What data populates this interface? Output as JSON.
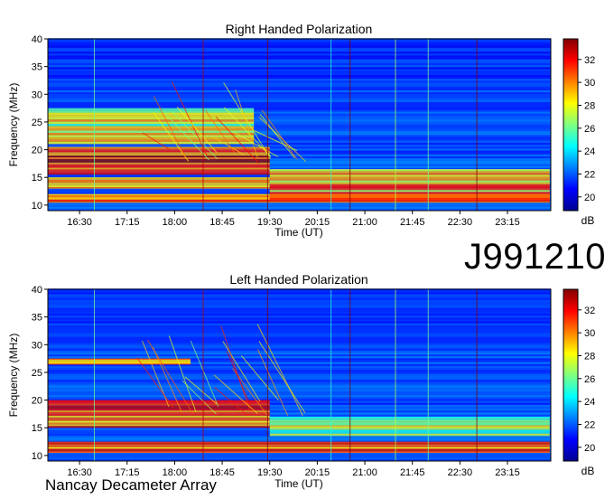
{
  "observation_id": "J991210",
  "credit": "Nancay Decameter Array",
  "chart_data": [
    {
      "type": "heatmap",
      "title": "Right Handed Polarization",
      "xlabel": "Time (UT)",
      "ylabel": "Frequency (MHz)",
      "x_tick_labels": [
        "16:30",
        "17:15",
        "18:00",
        "18:45",
        "19:30",
        "20:15",
        "21:00",
        "21:45",
        "22:30",
        "23:15"
      ],
      "y_ticks": [
        10,
        15,
        20,
        25,
        30,
        35,
        40
      ],
      "ylim": [
        9,
        40
      ],
      "colorbar": {
        "label": "dB",
        "ticks": [
          20,
          22,
          24,
          26,
          28,
          30,
          32
        ],
        "range": [
          18.8,
          33.8
        ]
      },
      "strong_bands": [
        {
          "f_low": 10.5,
          "f_high": 12,
          "t_start": "16:00",
          "t_end": "23:55",
          "level_db": 31
        },
        {
          "f_low": 13,
          "f_high": 15,
          "t_start": "16:00",
          "t_end": "19:30",
          "level_db": 30
        },
        {
          "f_low": 15.5,
          "f_high": 20.5,
          "t_start": "16:00",
          "t_end": "19:30",
          "level_db": 32
        },
        {
          "f_low": 21,
          "f_high": 27.5,
          "t_start": "16:00",
          "t_end": "19:15",
          "level_db": 28
        },
        {
          "f_low": 11,
          "f_high": 16.5,
          "t_start": "19:30",
          "t_end": "23:55",
          "level_db": 30
        }
      ]
    },
    {
      "type": "heatmap",
      "title": "Left Handed Polarization",
      "xlabel": "Time (UT)",
      "ylabel": "Frequency (MHz)",
      "x_tick_labels": [
        "16:30",
        "17:15",
        "18:00",
        "18:45",
        "19:30",
        "20:15",
        "21:00",
        "21:45",
        "22:30",
        "23:15"
      ],
      "y_ticks": [
        10,
        15,
        20,
        25,
        30,
        35,
        40
      ],
      "ylim": [
        9,
        40
      ],
      "colorbar": {
        "label": "dB",
        "ticks": [
          20,
          22,
          24,
          26,
          28,
          30,
          32
        ],
        "range": [
          18.8,
          33.8
        ]
      },
      "strong_bands": [
        {
          "f_low": 10.5,
          "f_high": 12.5,
          "t_start": "16:00",
          "t_end": "23:55",
          "level_db": 31
        },
        {
          "f_low": 15,
          "f_high": 20,
          "t_start": "16:00",
          "t_end": "19:30",
          "level_db": 31
        },
        {
          "f_low": 26.5,
          "f_high": 27.5,
          "t_start": "16:00",
          "t_end": "18:15",
          "level_db": 30
        },
        {
          "f_low": 13.5,
          "f_high": 17,
          "t_start": "19:30",
          "t_end": "23:55",
          "level_db": 27
        }
      ]
    }
  ]
}
